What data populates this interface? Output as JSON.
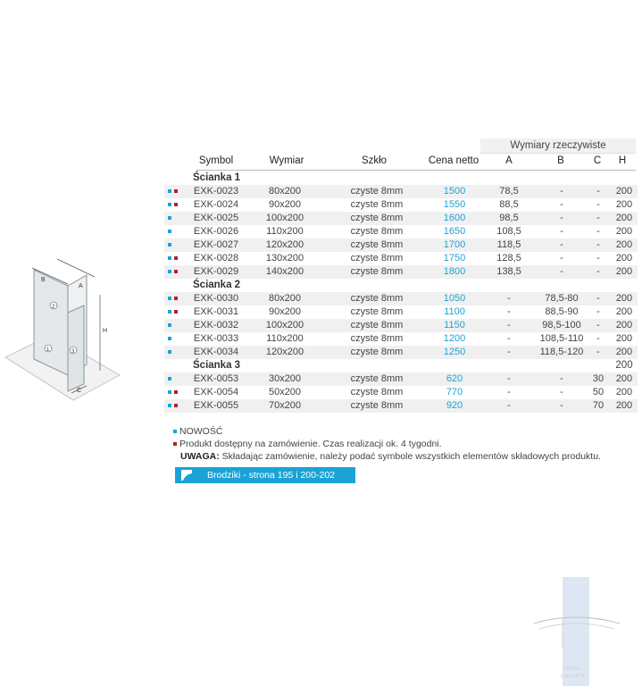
{
  "header": {
    "group_label": "Wymiary rzeczywiste",
    "columns": [
      "Symbol",
      "Wymiar",
      "Szkło",
      "Cena netto",
      "A",
      "B",
      "C",
      "H"
    ]
  },
  "diagram": {
    "labels": [
      "B",
      "A",
      "H",
      "2",
      "1",
      "3",
      "C"
    ]
  },
  "sections": [
    {
      "title": "Ścianka 1",
      "h": "",
      "rows": [
        {
          "markers": [
            "blue",
            "red"
          ],
          "symbol": "EXK-0023",
          "wymiar": "80x200",
          "szklo": "czyste 8mm",
          "cena": "1500",
          "a": "78,5",
          "b": "-",
          "c": "-",
          "h": "200"
        },
        {
          "markers": [
            "blue",
            "red"
          ],
          "symbol": "EXK-0024",
          "wymiar": "90x200",
          "szklo": "czyste 8mm",
          "cena": "1550",
          "a": "88,5",
          "b": "-",
          "c": "-",
          "h": "200"
        },
        {
          "markers": [
            "blue"
          ],
          "symbol": "EXK-0025",
          "wymiar": "100x200",
          "szklo": "czyste 8mm",
          "cena": "1600",
          "a": "98,5",
          "b": "-",
          "c": "-",
          "h": "200"
        },
        {
          "markers": [
            "blue"
          ],
          "symbol": "EXK-0026",
          "wymiar": "110x200",
          "szklo": "czyste 8mm",
          "cena": "1650",
          "a": "108,5",
          "b": "-",
          "c": "-",
          "h": "200"
        },
        {
          "markers": [
            "blue"
          ],
          "symbol": "EXK-0027",
          "wymiar": "120x200",
          "szklo": "czyste 8mm",
          "cena": "1700",
          "a": "118,5",
          "b": "-",
          "c": "-",
          "h": "200"
        },
        {
          "markers": [
            "blue",
            "red"
          ],
          "symbol": "EXK-0028",
          "wymiar": "130x200",
          "szklo": "czyste 8mm",
          "cena": "1750",
          "a": "128,5",
          "b": "-",
          "c": "-",
          "h": "200"
        },
        {
          "markers": [
            "blue",
            "red"
          ],
          "symbol": "EXK-0029",
          "wymiar": "140x200",
          "szklo": "czyste 8mm",
          "cena": "1800",
          "a": "138,5",
          "b": "-",
          "c": "-",
          "h": "200"
        }
      ]
    },
    {
      "title": "Ścianka 2",
      "h": "",
      "rows": [
        {
          "markers": [
            "blue",
            "red"
          ],
          "symbol": "EXK-0030",
          "wymiar": "80x200",
          "szklo": "czyste 8mm",
          "cena": "1050",
          "a": "-",
          "b": "78,5-80",
          "c": "-",
          "h": "200"
        },
        {
          "markers": [
            "blue",
            "red"
          ],
          "symbol": "EXK-0031",
          "wymiar": "90x200",
          "szklo": "czyste 8mm",
          "cena": "1100",
          "a": "-",
          "b": "88,5-90",
          "c": "-",
          "h": "200"
        },
        {
          "markers": [
            "blue"
          ],
          "symbol": "EXK-0032",
          "wymiar": "100x200",
          "szklo": "czyste 8mm",
          "cena": "1150",
          "a": "-",
          "b": "98,5-100",
          "c": "-",
          "h": "200"
        },
        {
          "markers": [
            "blue"
          ],
          "symbol": "EXK-0033",
          "wymiar": "110x200",
          "szklo": "czyste 8mm",
          "cena": "1200",
          "a": "-",
          "b": "108,5-110",
          "c": "-",
          "h": "200"
        },
        {
          "markers": [
            "blue"
          ],
          "symbol": "EXK-0034",
          "wymiar": "120x200",
          "szklo": "czyste 8mm",
          "cena": "1250",
          "a": "-",
          "b": "118,5-120",
          "c": "-",
          "h": "200"
        }
      ]
    },
    {
      "title": "Ścianka 3",
      "h": "200",
      "rows": [
        {
          "markers": [
            "blue"
          ],
          "symbol": "EXK-0053",
          "wymiar": "30x200",
          "szklo": "czyste 8mm",
          "cena": "620",
          "a": "-",
          "b": "-",
          "c": "30",
          "h": "200"
        },
        {
          "markers": [
            "blue",
            "red"
          ],
          "symbol": "EXK-0054",
          "wymiar": "50x200",
          "szklo": "czyste 8mm",
          "cena": "770",
          "a": "-",
          "b": "-",
          "c": "50",
          "h": "200"
        },
        {
          "markers": [
            "blue",
            "red"
          ],
          "symbol": "EXK-0055",
          "wymiar": "70x200",
          "szklo": "czyste 8mm",
          "cena": "920",
          "a": "-",
          "b": "-",
          "c": "70",
          "h": "200"
        }
      ]
    }
  ],
  "notes": {
    "nowosc": "NOWOŚĆ",
    "order": "Produkt dostępny na zamówienie. Czas realizacji ok. 4 tygodni.",
    "uwaga_label": "UWAGA:",
    "uwaga_text": " Składając zamówienie, należy podać symbole wszystkich elementów składowych produktu."
  },
  "banner": {
    "text": "Brodziki - strona 195 i 200-202"
  },
  "brand": {
    "lines": [
      "vennu",
      "passule"
    ]
  },
  "colors": {
    "accent": "#1aa3d6",
    "marker_red": "#b22030"
  }
}
